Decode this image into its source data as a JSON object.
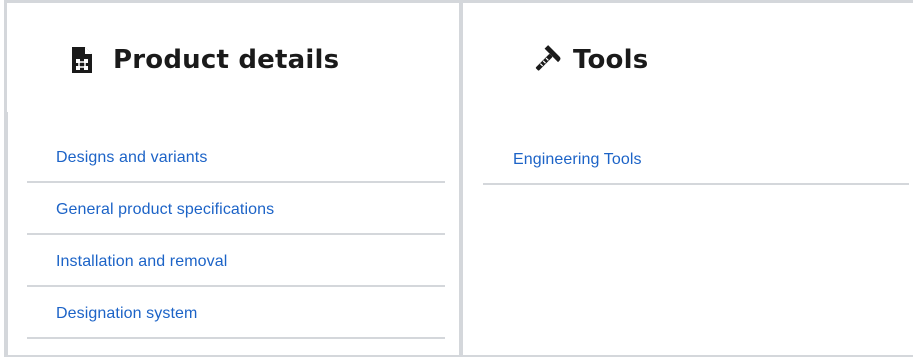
{
  "product_details": {
    "title": "Product details",
    "icon": "document-diagram-icon",
    "links": [
      "Designs and variants",
      "General product specifications",
      "Installation and removal",
      "Designation system"
    ]
  },
  "tools": {
    "title": "Tools",
    "icon": "hammer-icon",
    "links": [
      "Engineering Tools"
    ]
  },
  "colors": {
    "link": "#1c63c7",
    "border": "#d4d7db",
    "title": "#1a1a1a"
  }
}
